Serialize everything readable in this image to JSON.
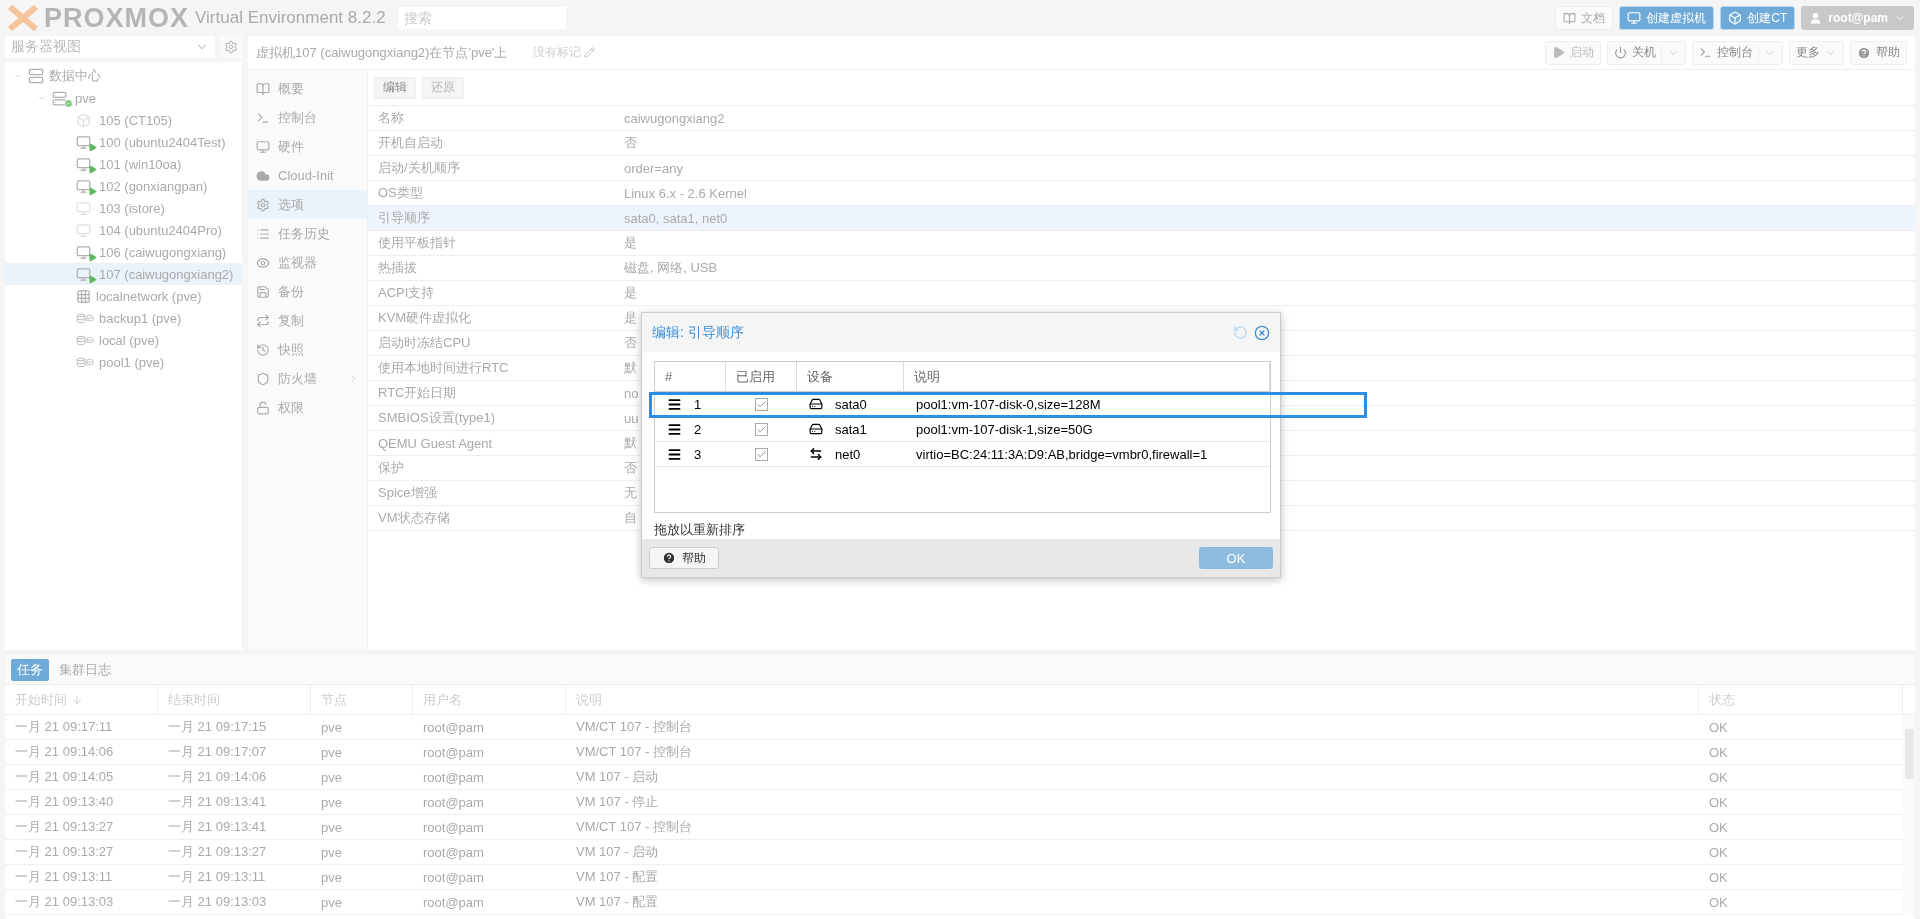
{
  "topbar": {
    "logo": "PROXMOX",
    "product": "Virtual Environment 8.2.2",
    "search": {
      "placeholder": "搜索"
    },
    "buttons": [
      {
        "kind": "docs",
        "label": "文档"
      },
      {
        "kind": "vm",
        "label": "创建虚拟机"
      },
      {
        "kind": "ct",
        "label": "创建CT"
      }
    ],
    "user": "root@pam"
  },
  "sidebar": {
    "view": "服务器视图",
    "tree": [
      {
        "label": "数据中心",
        "kind": "datacenter",
        "selected": false,
        "children": [
          {
            "label": "pve",
            "kind": "node",
            "online": true,
            "selected": false,
            "children": [
              {
                "label": "105 (CT105)",
                "kind": "ct",
                "running": false,
                "selected": false
              },
              {
                "label": "100 (ubuntu2404Test)",
                "kind": "vm",
                "running": true,
                "selected": false
              },
              {
                "label": "101 (win10oa)",
                "kind": "vm",
                "running": true,
                "selected": false
              },
              {
                "label": "102 (gonxiangpan)",
                "kind": "vm",
                "running": true,
                "selected": false
              },
              {
                "label": "103 (istore)",
                "kind": "vm",
                "running": false,
                "selected": false
              },
              {
                "label": "104 (ubuntu2404Pro)",
                "kind": "vm",
                "running": false,
                "selected": false
              },
              {
                "label": "106 (caiwugongxiang)",
                "kind": "vm",
                "running": true,
                "selected": false
              },
              {
                "label": "107 (caiwugongxiang2)",
                "kind": "vm",
                "running": true,
                "selected": true
              },
              {
                "label": "localnetwork (pve)",
                "kind": "sdn",
                "selected": false
              },
              {
                "label": "backup1 (pve)",
                "kind": "storage",
                "selected": false
              },
              {
                "label": "local (pve)",
                "kind": "storage",
                "selected": false
              },
              {
                "label": "pool1 (pve)",
                "kind": "storage",
                "selected": false
              }
            ]
          }
        ]
      }
    ]
  },
  "main": {
    "title": "虚拟机107 (caiwugongxiang2)在节点'pve'上",
    "tags": "没有标记",
    "buttons": [
      {
        "kind": "start",
        "label": "启动",
        "disabled": true
      },
      {
        "kind": "shutdown",
        "label": "关机",
        "disabled": false
      },
      {
        "kind": "console",
        "label": "控制台",
        "disabled": false
      },
      {
        "kind": "more",
        "label": "更多",
        "disabled": false
      },
      {
        "kind": "help",
        "label": "帮助",
        "disabled": false
      }
    ],
    "nav": [
      {
        "kind": "summary",
        "label": "概要",
        "selected": false
      },
      {
        "kind": "console",
        "label": "控制台",
        "selected": false
      },
      {
        "kind": "hardware",
        "label": "硬件",
        "selected": false
      },
      {
        "kind": "cloud",
        "label": "Cloud-Init",
        "selected": false
      },
      {
        "kind": "options",
        "label": "选项",
        "selected": true
      },
      {
        "kind": "tasks",
        "label": "任务历史",
        "selected": false
      },
      {
        "kind": "monitor",
        "label": "监视器",
        "selected": false
      },
      {
        "kind": "backup",
        "label": "备份",
        "selected": false
      },
      {
        "kind": "replication",
        "label": "复制",
        "selected": false
      },
      {
        "kind": "snapshot",
        "label": "快照",
        "selected": false
      },
      {
        "kind": "firewall",
        "label": "防火墙",
        "selected": false,
        "expandable": true
      },
      {
        "kind": "permissions",
        "label": "权限",
        "selected": false
      }
    ],
    "toolbar": [
      {
        "label": "编辑",
        "disabled": false
      },
      {
        "label": "还原",
        "disabled": true
      }
    ],
    "options": [
      {
        "name": "名称",
        "value": "caiwugongxiang2",
        "selected": false
      },
      {
        "name": "开机自启动",
        "value": "否",
        "selected": false
      },
      {
        "name": "启动/关机顺序",
        "value": "order=any",
        "selected": false
      },
      {
        "name": "OS类型",
        "value": "Linux 6.x - 2.6 Kernel",
        "selected": false
      },
      {
        "name": "引导顺序",
        "value": "sata0, sata1, net0",
        "selected": true
      },
      {
        "name": "使用平板指针",
        "value": "是",
        "selected": false
      },
      {
        "name": "热插拔",
        "value": "磁盘, 网络, USB",
        "selected": false
      },
      {
        "name": "ACPI支持",
        "value": "是",
        "selected": false
      },
      {
        "name": "KVM硬件虚拟化",
        "value": "是",
        "selected": false
      },
      {
        "name": "启动时冻结CPU",
        "value": "否",
        "selected": false
      },
      {
        "name": "使用本地时间进行RTC",
        "value": "默",
        "selected": false
      },
      {
        "name": "RTC开始日期",
        "value": "no",
        "selected": false
      },
      {
        "name": "SMBIOS设置(type1)",
        "value": "uu",
        "selected": false
      },
      {
        "name": "QEMU Guest Agent",
        "value": "默",
        "selected": false
      },
      {
        "name": "保护",
        "value": "否",
        "selected": false
      },
      {
        "name": "Spice增强",
        "value": "无",
        "selected": false
      },
      {
        "name": "VM状态存储",
        "value": "自",
        "selected": false
      }
    ]
  },
  "dialog": {
    "title": "编辑: 引导顺序",
    "columns": [
      "#",
      "已启用",
      "设备",
      "说明"
    ],
    "rows": [
      {
        "num": "1",
        "enabled": true,
        "kind": "disk",
        "device": "sata0",
        "description": "pool1:vm-107-disk-0,size=128M",
        "dragging": true
      },
      {
        "num": "2",
        "enabled": true,
        "kind": "disk",
        "device": "sata1",
        "description": "pool1:vm-107-disk-1,size=50G",
        "dragging": false
      },
      {
        "num": "3",
        "enabled": true,
        "kind": "net",
        "device": "net0",
        "description": "virtio=BC:24:11:3A:D9:AB,bridge=vmbr0,firewall=1",
        "dragging": false
      }
    ],
    "hint": "拖放以重新排序",
    "help": "帮助",
    "ok": {
      "label": "OK",
      "disabled": true
    }
  },
  "log": {
    "tabs": [
      {
        "label": "任务",
        "selected": true
      },
      {
        "label": "集群日志",
        "selected": false
      }
    ],
    "columns": [
      "开始时间",
      "结束时间",
      "节点",
      "用户名",
      "说明",
      "状态"
    ],
    "rows": [
      [
        "一月 21 09:17:11",
        "一月 21 09:17:15",
        "pve",
        "root@pam",
        "VM/CT 107 - 控制台",
        "OK"
      ],
      [
        "一月 21 09:14:06",
        "一月 21 09:17:07",
        "pve",
        "root@pam",
        "VM/CT 107 - 控制台",
        "OK"
      ],
      [
        "一月 21 09:14:05",
        "一月 21 09:14:06",
        "pve",
        "root@pam",
        "VM 107 - 启动",
        "OK"
      ],
      [
        "一月 21 09:13:40",
        "一月 21 09:13:41",
        "pve",
        "root@pam",
        "VM 107 - 停止",
        "OK"
      ],
      [
        "一月 21 09:13:27",
        "一月 21 09:13:41",
        "pve",
        "root@pam",
        "VM/CT 107 - 控制台",
        "OK"
      ],
      [
        "一月 21 09:13:27",
        "一月 21 09:13:27",
        "pve",
        "root@pam",
        "VM 107 - 启动",
        "OK"
      ],
      [
        "一月 21 09:13:11",
        "一月 21 09:13:11",
        "pve",
        "root@pam",
        "VM 107 - 配置",
        "OK"
      ],
      [
        "一月 21 09:13:03",
        "一月 21 09:13:03",
        "pve",
        "root@pam",
        "VM 107 - 配置",
        "OK"
      ]
    ]
  }
}
